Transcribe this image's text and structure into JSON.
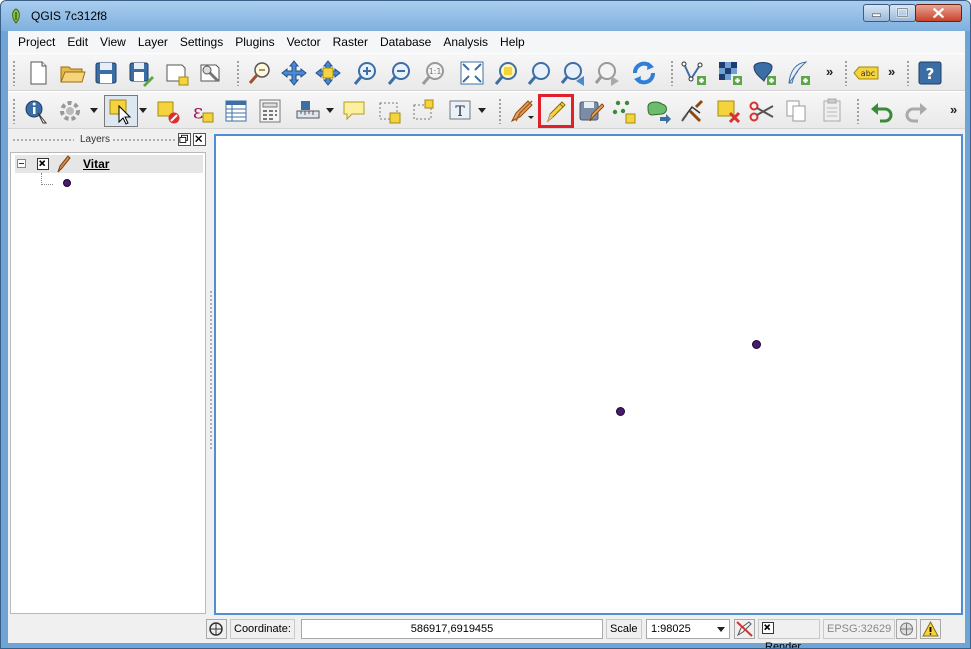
{
  "window": {
    "title": "QGIS 7c312f8"
  },
  "menubar": {
    "items": [
      "Project",
      "Edit",
      "View",
      "Layer",
      "Settings",
      "Plugins",
      "Vector",
      "Raster",
      "Database",
      "Analysis",
      "Help"
    ]
  },
  "toolbar": {
    "more_glyph": "»",
    "label_tool_text": "abc",
    "help_glyph": "?",
    "text_annotation_glyph": "T",
    "expression_glyph": "ε",
    "zoom_native_text": "1:1"
  },
  "layers_panel": {
    "title": "Layers",
    "layers": [
      {
        "name": "Vitar",
        "visible": true,
        "symbol_color": "#4a1a6e"
      }
    ]
  },
  "statusbar": {
    "coordinate_label": "Coordinate:",
    "coordinate_value": "586917,6919455",
    "scale_label": "Scale",
    "scale_value": "1:98025",
    "render_label": "Render",
    "render_checked": true,
    "crs_label": "EPSG:32629"
  },
  "colors": {
    "highlight": "#e0202a",
    "point": "#4a1a6e",
    "canvas_border": "#4f8fd1"
  }
}
